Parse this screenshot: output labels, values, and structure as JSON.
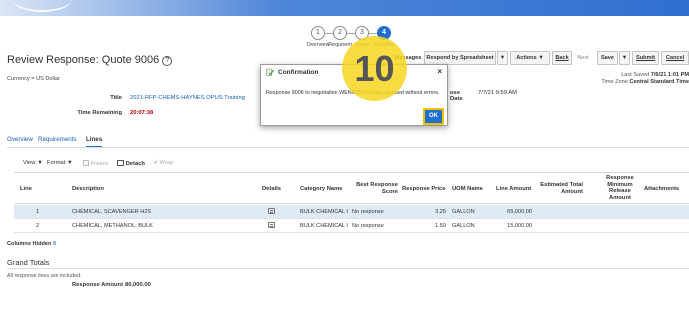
{
  "train": {
    "steps": [
      {
        "num": "1",
        "label": "Overview"
      },
      {
        "num": "2",
        "label": "Requirem"
      },
      {
        "num": "3",
        "label": "Lines"
      },
      {
        "num": "4",
        "label": "Review"
      }
    ]
  },
  "page": {
    "title": "Review Response: Quote 9006",
    "help_icon": "?",
    "currency": "Currency = US Dollar"
  },
  "toolbar": {
    "messages": "Messages",
    "respond_by_spreadsheet": "Respond by Spreadsheet",
    "actions": "Actions",
    "back": "Back",
    "next": "Next",
    "save": "Save",
    "submit": "Submit",
    "cancel": "Cancel",
    "dropdown_glyph": "▼"
  },
  "status": {
    "last_saved_label": "Last Saved",
    "last_saved_value": "7/6/21 1:01 PM",
    "time_zone_label": "Time Zone",
    "time_zone_value": "Central Standard Time"
  },
  "header_fields": {
    "title_label": "Title",
    "title_value": "2021-RFP-CHEMS-HAYNES OPUS Training",
    "time_remaining_label": "Time Remaining",
    "time_remaining_value": "20:07:38",
    "close_date_label": "ose Date",
    "close_date_value": "7/7/21 9:59 AM"
  },
  "tabs": [
    {
      "label": "Overview"
    },
    {
      "label": "Requirements"
    },
    {
      "label": "Lines"
    }
  ],
  "lines_toolbar": {
    "view": "View",
    "format": "Format",
    "freeze": "Freeze",
    "detach": "Detach",
    "wrap": "Wrap"
  },
  "grid": {
    "headers": {
      "line": "Line",
      "description": "Description",
      "details": "Details",
      "category": "Category Name",
      "best_score": [
        "Best Response",
        "Score"
      ],
      "price": "Response Price",
      "uom": "UOM Name",
      "amount": "Line Amount",
      "est_total": [
        "Estimated Total",
        "Amount"
      ],
      "min_release": [
        "Response",
        "Minimum",
        "Release",
        "Amount"
      ],
      "attachments": "Attachments"
    },
    "rows": [
      {
        "line": "1",
        "description": "CHEMICAL, SCAVENGER H2S",
        "category": "BULK CHEMICAL I",
        "best_score": "No response",
        "price": "3.25",
        "uom": "GALLON",
        "amount": "65,000.00"
      },
      {
        "line": "2",
        "description": "CHEMICAL, METHANOL, BULK",
        "category": "BULK CHEMICAL I",
        "best_score": "No response",
        "price": "1.50",
        "uom": "GALLON",
        "amount": "15,000.00"
      }
    ]
  },
  "columns_hidden": {
    "label": "Columns Hidden",
    "count": "8"
  },
  "totals": {
    "heading": "Grand Totals",
    "note": "All response lines are included.",
    "response_amount_label": "Response Amount",
    "response_amount_value": "80,000.00"
  },
  "dialog": {
    "title": "Confirmation",
    "message": "Response 9006 to negotiation WEN000000 was validated without errors.",
    "close_glyph": "×",
    "ok": "OK"
  },
  "callout": {
    "number": "10",
    "color": "#f7d620"
  },
  "colors": {
    "accent": "#1f6fd1",
    "link": "#1a5fb4",
    "warning": "#c40000"
  }
}
